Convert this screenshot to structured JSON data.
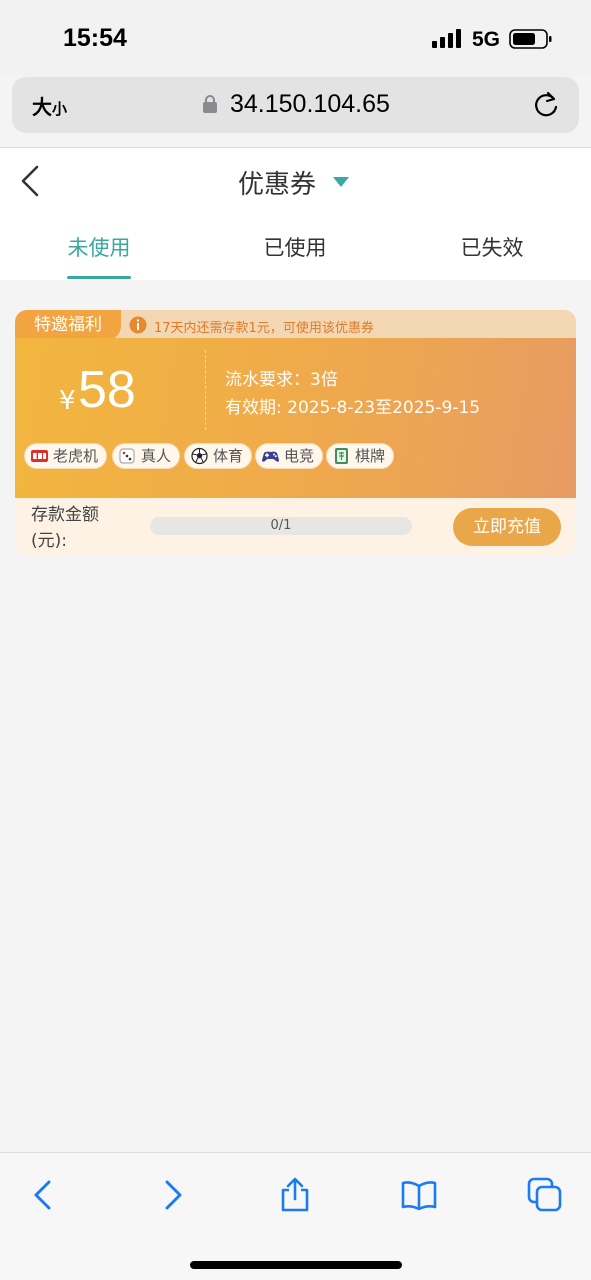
{
  "status_bar": {
    "time": "15:54",
    "network": "5G"
  },
  "url_bar": {
    "text_size_large": "大",
    "text_size_small": "小",
    "url": "34.150.104.65"
  },
  "header": {
    "title": "优惠券"
  },
  "tabs": [
    {
      "label": "未使用",
      "active": true
    },
    {
      "label": "已使用",
      "active": false
    },
    {
      "label": "已失效",
      "active": false
    }
  ],
  "coupon": {
    "tag": "特邀福利",
    "notice": "17天内还需存款1元，可使用该优惠券",
    "currency": "¥",
    "amount": "58",
    "turnover": "流水要求：3倍",
    "validity": "有效期: 2025-8-23至2025-9-15",
    "games": [
      {
        "label": "老虎机",
        "icon": "slot-machine-icon"
      },
      {
        "label": "真人",
        "icon": "dice-icon"
      },
      {
        "label": "体育",
        "icon": "soccer-ball-icon"
      },
      {
        "label": "电竞",
        "icon": "gamepad-icon"
      },
      {
        "label": "棋牌",
        "icon": "mahjong-tile-icon"
      }
    ],
    "deposit_label": "存款金额(元):",
    "progress_text": "0/1",
    "progress_fraction": 0,
    "recharge_label": "立即充值"
  },
  "colors": {
    "accent": "#3aa8a2",
    "coupon_orange": "#efa94c",
    "notice_orange": "#e07a2a"
  }
}
